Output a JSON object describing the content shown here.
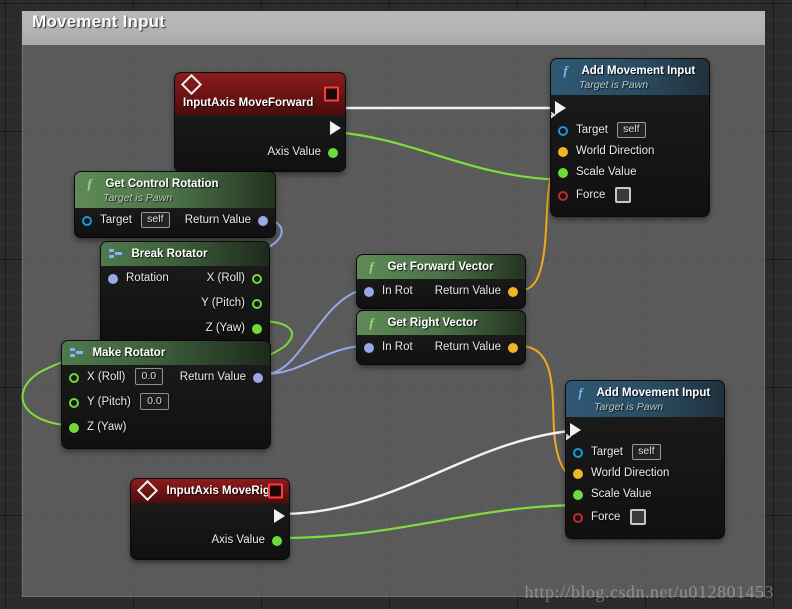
{
  "comment": {
    "title": "Movement Input"
  },
  "watermark": "http://blog.csdn.net/u012801453",
  "labels": {
    "target": "Target",
    "self": "self",
    "world_direction": "World Direction",
    "scale_value": "Scale Value",
    "force": "Force",
    "return_value": "Return Value",
    "axis_value": "Axis Value",
    "rotation": "Rotation",
    "in_rot": "In Rot",
    "x_roll": "X (Roll)",
    "y_pitch": "Y (Pitch)",
    "z_yaw": "Z (Yaw)",
    "zero": "0.0",
    "target_is_pawn": "Target is Pawn"
  },
  "nodes": {
    "input_axis_move_forward": {
      "title": "InputAxis MoveForward",
      "icon": "event-diamond-icon",
      "header_color": "#6e1414",
      "pins": {
        "exec_out": "",
        "axis_value": "Axis Value"
      }
    },
    "input_axis_move_right": {
      "title": "InputAxis MoveRight",
      "icon": "event-diamond-icon",
      "header_color": "#6e1414",
      "pins": {
        "exec_out": "",
        "axis_value": "Axis Value"
      }
    },
    "add_movement_input_top": {
      "title": "Add Movement Input",
      "subtitle": "Target is Pawn",
      "icon": "function-f-icon",
      "header_color": "#2a4c63",
      "pins": {
        "target": "Target",
        "target_value": "self",
        "world_direction": "World Direction",
        "scale_value": "Scale Value",
        "force": "Force"
      }
    },
    "add_movement_input_bottom": {
      "title": "Add Movement Input",
      "subtitle": "Target is Pawn",
      "icon": "function-f-icon",
      "header_color": "#2a4c63",
      "pins": {
        "target": "Target",
        "target_value": "self",
        "world_direction": "World Direction",
        "scale_value": "Scale Value",
        "force": "Force"
      }
    },
    "get_control_rotation": {
      "title": "Get Control Rotation",
      "subtitle": "Target is Pawn",
      "icon": "function-f-icon",
      "header_color": "#4c7349",
      "pins": {
        "target": "Target",
        "target_value": "self",
        "return_value": "Return Value"
      }
    },
    "break_rotator": {
      "title": "Break Rotator",
      "icon": "struct-break-icon",
      "header_color": "#3d5f3b",
      "pins": {
        "rotation": "Rotation",
        "x_roll": "X (Roll)",
        "y_pitch": "Y (Pitch)",
        "z_yaw": "Z (Yaw)"
      }
    },
    "make_rotator": {
      "title": "Make Rotator",
      "icon": "struct-make-icon",
      "header_color": "#3d5f3b",
      "pins": {
        "x_roll": "X (Roll)",
        "x_roll_value": "0.0",
        "y_pitch": "Y (Pitch)",
        "y_pitch_value": "0.0",
        "z_yaw": "Z (Yaw)",
        "return_value": "Return Value"
      }
    },
    "get_forward_vector": {
      "title": "Get Forward Vector",
      "icon": "function-f-icon",
      "header_color": "#4c7349",
      "pins": {
        "in_rot": "In Rot",
        "return_value": "Return Value"
      }
    },
    "get_right_vector": {
      "title": "Get Right Vector",
      "icon": "function-f-icon",
      "header_color": "#4c7349",
      "pins": {
        "in_rot": "In Rot",
        "return_value": "Return Value"
      }
    }
  },
  "wire_colors": {
    "exec": "#f2f2f2",
    "float": "#6fdb3a",
    "vector": "#f0b429",
    "rotator": "#98a8e8"
  }
}
